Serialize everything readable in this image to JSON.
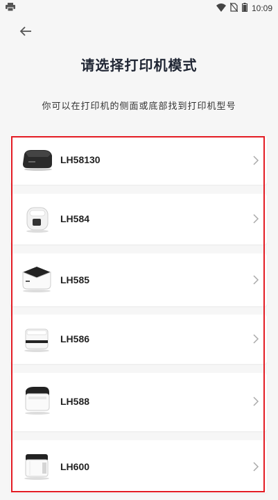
{
  "status_bar": {
    "time": "10:09",
    "left_icons": [
      "printer-icon"
    ],
    "right_icons": [
      "wifi-icon",
      "no-sim-icon",
      "battery-icon"
    ]
  },
  "header": {
    "back_icon": "arrow-left-icon",
    "title": "请选择打印机模式",
    "subtitle": "你可以在打印机的侧面或底部找到打印机型号"
  },
  "printers": [
    {
      "model": "LH58130",
      "thumbnail": "printer-thumbnail-icon"
    },
    {
      "model": "LH584",
      "thumbnail": "printer-thumbnail-icon"
    },
    {
      "model": "LH585",
      "thumbnail": "printer-thumbnail-icon"
    },
    {
      "model": "LH586",
      "thumbnail": "printer-thumbnail-icon"
    },
    {
      "model": "LH588",
      "thumbnail": "printer-thumbnail-icon"
    },
    {
      "model": "LH600",
      "thumbnail": "printer-thumbnail-icon"
    }
  ],
  "colors": {
    "background": "#f6f6f6",
    "card": "#ffffff",
    "highlight": "#e31b23",
    "title": "#1f2533"
  }
}
